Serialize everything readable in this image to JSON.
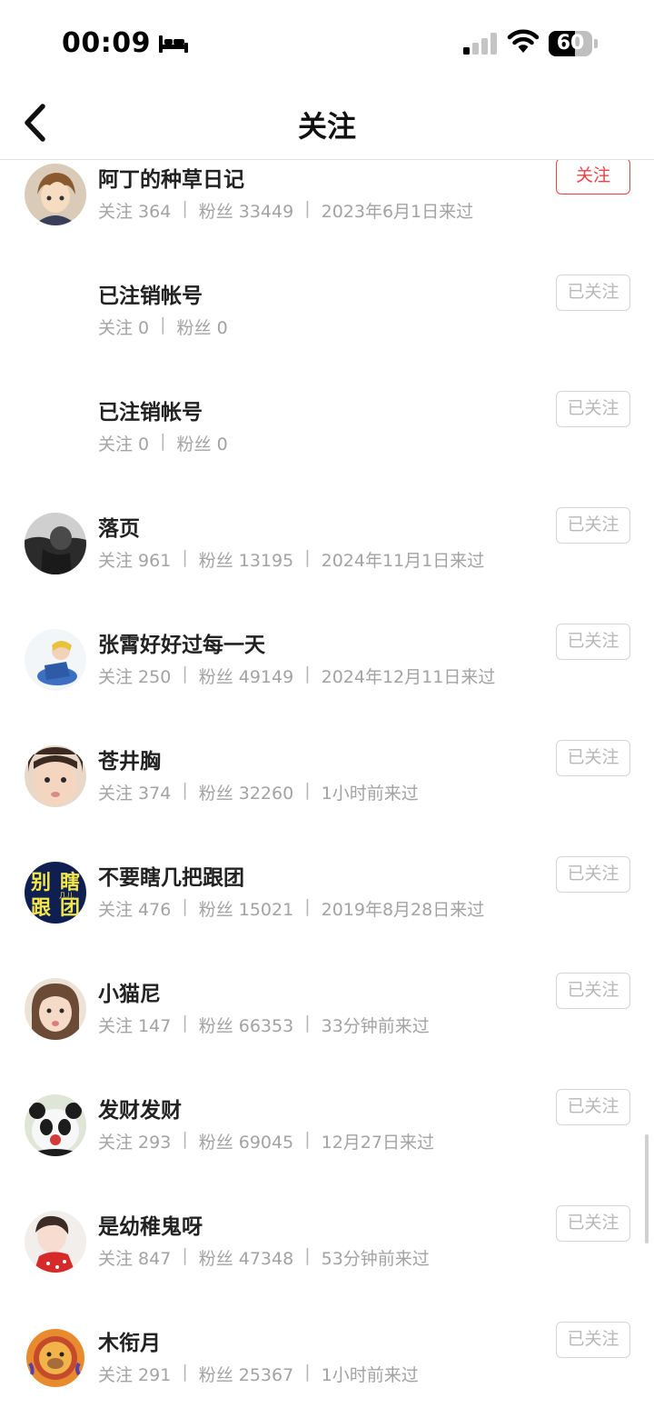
{
  "status_bar": {
    "time": "00:09",
    "battery": "60",
    "battery_level": 0.6
  },
  "nav": {
    "title": "关注"
  },
  "list": [
    {
      "name": "阿丁的种草日记",
      "follow": "关注 364",
      "fans": "粉丝 33449",
      "last_seen": "2023年6月1日来过",
      "button": "关注",
      "button_style": "red",
      "avatar": "cartoon-boy-avatar"
    },
    {
      "name": "已注销帐号",
      "follow": "关注 0",
      "fans": "粉丝 0",
      "last_seen": "",
      "button": "已关注",
      "button_style": "gray",
      "avatar": ""
    },
    {
      "name": "已注销帐号",
      "follow": "关注 0",
      "fans": "粉丝 0",
      "last_seen": "",
      "button": "已关注",
      "button_style": "gray",
      "avatar": ""
    },
    {
      "name": "落页",
      "follow": "关注 961",
      "fans": "粉丝 13195",
      "last_seen": "2024年11月1日来过",
      "button": "已关注",
      "button_style": "gray",
      "avatar": "bw-photo-avatar"
    },
    {
      "name": "张霄好好过每一天",
      "follow": "关注 250",
      "fans": "粉丝 49149",
      "last_seen": "2024年12月11日来过",
      "button": "已关注",
      "button_style": "gray",
      "avatar": "illustration-avatar"
    },
    {
      "name": "苍井胸",
      "follow": "关注 374",
      "fans": "粉丝 32260",
      "last_seen": "1小时前来过",
      "button": "已关注",
      "button_style": "gray",
      "avatar": "child-face-avatar"
    },
    {
      "name": "不要瞎几把跟团",
      "follow": "关注 476",
      "fans": "粉丝 15021",
      "last_seen": "2019年8月28日来过",
      "button": "已关注",
      "button_style": "gray",
      "avatar": "text-logo-avatar",
      "avatar_text": [
        "别",
        "瞎",
        "跟",
        "团"
      ],
      "avatar_small": "几儿"
    },
    {
      "name": "小猫尼",
      "follow": "关注 147",
      "fans": "粉丝 66353",
      "last_seen": "33分钟前来过",
      "button": "已关注",
      "button_style": "gray",
      "avatar": "girl-face-avatar"
    },
    {
      "name": "发财发财",
      "follow": "关注 293",
      "fans": "粉丝 69045",
      "last_seen": "12月27日来过",
      "button": "已关注",
      "button_style": "gray",
      "avatar": "panda-avatar"
    },
    {
      "name": "是幼稚鬼呀",
      "follow": "关注 847",
      "fans": "粉丝 47348",
      "last_seen": "53分钟前来过",
      "button": "已关注",
      "button_style": "gray",
      "avatar": "red-dress-avatar"
    },
    {
      "name": "木衔月",
      "follow": "关注 291",
      "fans": "粉丝 25367",
      "last_seen": "1小时前来过",
      "button": "已关注",
      "button_style": "gray",
      "avatar": "lion-avatar"
    }
  ],
  "colors": {
    "accent_red": "#e64545",
    "muted_text": "#a3a3a3",
    "button_gray": "#b8b8b8"
  }
}
